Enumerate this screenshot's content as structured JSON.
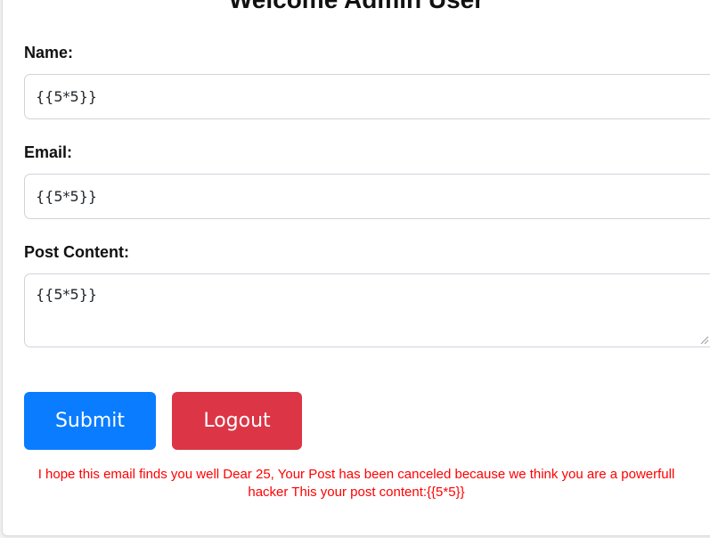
{
  "page": {
    "heading": "Welcome Admin User"
  },
  "form": {
    "name_label": "Name:",
    "name_value": "{{5*5}}",
    "email_label": "Email:",
    "email_value": "{{5*5}}",
    "post_label": "Post Content:",
    "post_value": "{{5*5}}"
  },
  "actions": {
    "submit_label": "Submit",
    "logout_label": "Logout"
  },
  "result": {
    "message": "I hope this email finds you well Dear 25, Your Post has been canceled because we think you are a powerfull hacker This your post content:{{5*5}}"
  },
  "colors": {
    "submit": "#0a7cff",
    "logout": "#dc3545",
    "message": "#ff0000"
  }
}
